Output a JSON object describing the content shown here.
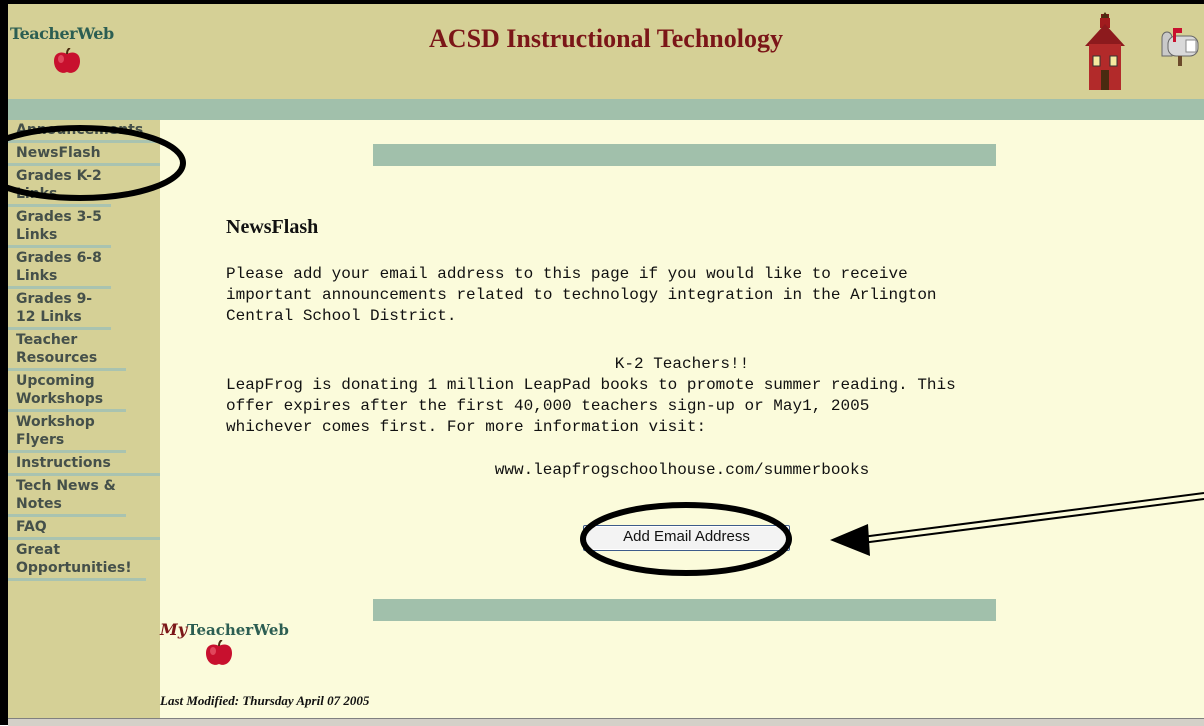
{
  "header": {
    "logo_text": "TeacherWeb",
    "title": "ACSD Instructional Technology",
    "icons": [
      "apple-icon",
      "schoolhouse-icon",
      "mailbox-icon"
    ]
  },
  "sidebar": {
    "items": [
      {
        "label": "Announcements"
      },
      {
        "label": "NewsFlash"
      },
      {
        "label": "Grades K-2 Links"
      },
      {
        "label": "Grades 3-5 Links"
      },
      {
        "label": "Grades 6-8 Links"
      },
      {
        "label": "Grades 9-12 Links"
      },
      {
        "label": "Teacher Resources"
      },
      {
        "label": "Upcoming Workshops"
      },
      {
        "label": "Workshop Flyers"
      },
      {
        "label": "Instructions"
      },
      {
        "label": "Tech News & Notes"
      },
      {
        "label": "FAQ"
      },
      {
        "label": "Great Opportunities!"
      }
    ]
  },
  "main": {
    "heading": "NewsFlash",
    "intro": "Please add your email address to this page if you would like to receive\nimportant announcements related to technology integration in the Arlington\nCentral School District.",
    "k2_title": "K-2 Teachers!!",
    "k2_body": "LeapFrog is donating 1 million LeapPad books to promote summer reading. This\noffer expires after the first 40,000 teachers sign-up or May1, 2005\nwhichever comes first. For more information visit:",
    "url": "www.leapfrogschoolhouse.com/summerbooks",
    "add_email_label": "Add Email Address"
  },
  "footer": {
    "logo_my": "My",
    "logo_text": "TeacherWeb",
    "last_modified": "Last Modified: Thursday April 07 2005"
  },
  "colors": {
    "header_bg": "#d5d096",
    "band": "#a1c0ab",
    "content_bg": "#fbfbdb",
    "title": "#7b1618"
  }
}
